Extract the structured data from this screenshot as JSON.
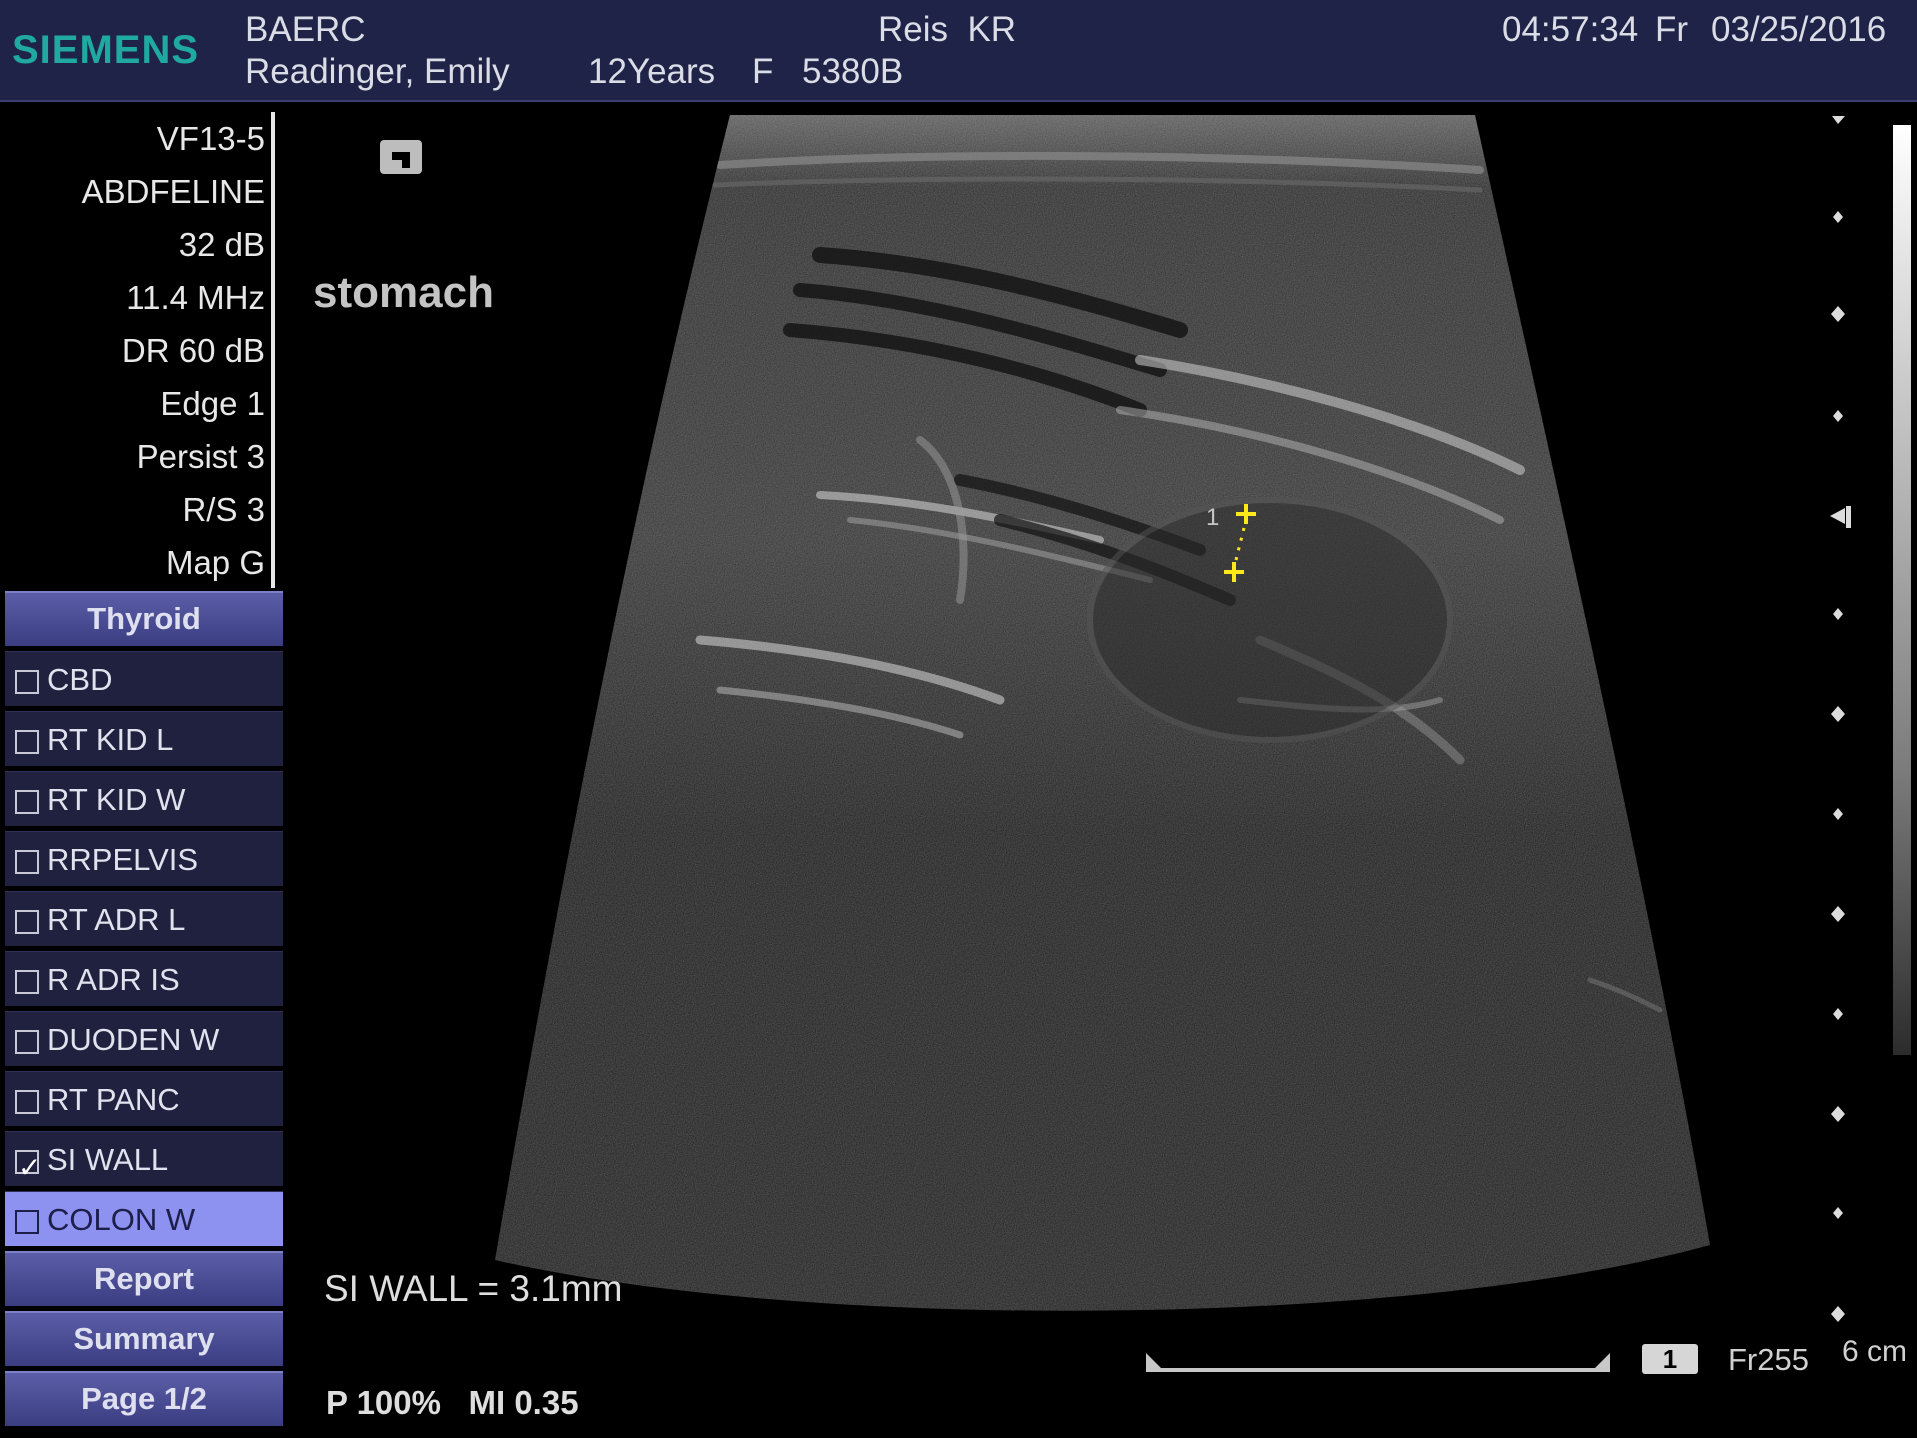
{
  "header": {
    "brand": "SIEMENS",
    "institution": "BAERC",
    "operator": "Reis  KR",
    "time": "04:57:34",
    "day": "Fr",
    "date": "03/25/2016",
    "patient_name": "Readinger, Emily",
    "patient_age": "12Years",
    "patient_sex": "F",
    "patient_id": "5380B"
  },
  "parameters": [
    "VF13-5",
    "ABDFELINE",
    "32 dB",
    "11.4 MHz",
    "DR 60 dB",
    "Edge 1",
    "Persist 3",
    "R/S 3",
    "Map G"
  ],
  "menu": {
    "header": "Thyroid",
    "items": [
      {
        "label": "CBD",
        "checked": false,
        "selected": false
      },
      {
        "label": "RT KID L",
        "checked": false,
        "selected": false
      },
      {
        "label": "RT KID W",
        "checked": false,
        "selected": false
      },
      {
        "label": "RRPELVIS",
        "checked": false,
        "selected": false
      },
      {
        "label": "RT ADR L",
        "checked": false,
        "selected": false
      },
      {
        "label": "R ADR IS",
        "checked": false,
        "selected": false
      },
      {
        "label": "DUODEN W",
        "checked": false,
        "selected": false
      },
      {
        "label": "RT PANC",
        "checked": false,
        "selected": false
      },
      {
        "label": "SI WALL",
        "checked": true,
        "selected": false
      },
      {
        "label": "COLON W",
        "checked": false,
        "selected": true
      }
    ],
    "report": "Report",
    "summary": "Summary",
    "page": "Page 1/2"
  },
  "image": {
    "annotation": "stomach",
    "caliper_label": "1",
    "measurement": "SI WALL = 3.1mm",
    "power": "P 100%",
    "mi": "MI 0.35",
    "frame_number": "1",
    "frame_rate": "Fr255",
    "depth": "6 cm"
  },
  "colors": {
    "header_bg": "#1f2347",
    "brand": "#20a9a2",
    "menu_button": "#4a4d96",
    "menu_selected": "#8d91ef",
    "caliper": "#ffe81a"
  }
}
